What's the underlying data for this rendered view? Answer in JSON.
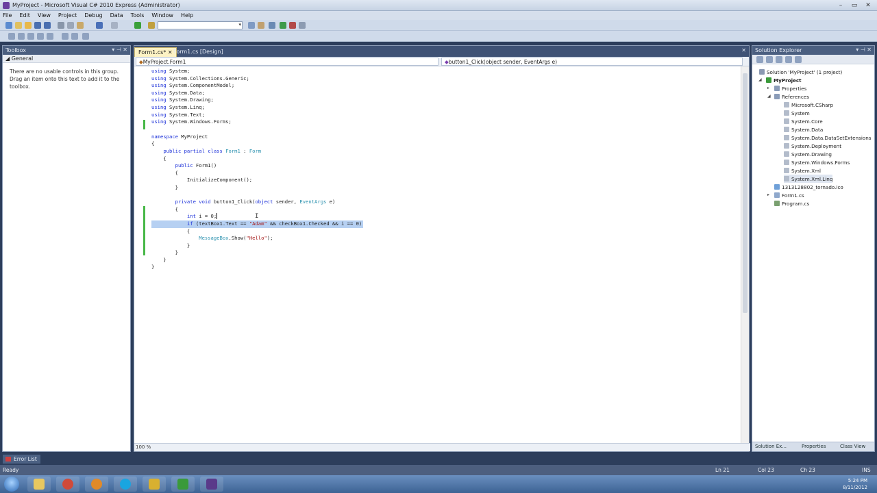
{
  "window": {
    "title": "MyProject - Microsoft Visual C# 2010 Express (Administrator)"
  },
  "menu": [
    "File",
    "Edit",
    "View",
    "Project",
    "Debug",
    "Data",
    "Tools",
    "Window",
    "Help"
  ],
  "toolbox": {
    "title": "Toolbox",
    "group": "General",
    "message": "There are no usable controls in this group. Drag an item onto this text to add it to the toolbox."
  },
  "editor": {
    "tabs": [
      {
        "label": "Form1.cs*",
        "active": true
      },
      {
        "label": "Form1.cs [Design]",
        "active": false
      }
    ],
    "nav_left": "MyProject.Form1",
    "nav_right": "button1_Click(object sender, EventArgs e)",
    "zoom": "100 %",
    "code_lines": [
      "using System;",
      "using System.Collections.Generic;",
      "using System.ComponentModel;",
      "using System.Data;",
      "using System.Drawing;",
      "using System.Linq;",
      "using System.Text;",
      "using System.Windows.Forms;",
      "",
      "namespace MyProject",
      "{",
      "    public partial class Form1 : Form",
      "    {",
      "        public Form1()",
      "        {",
      "            InitializeComponent();",
      "        }",
      "",
      "        private void button1_Click(object sender, EventArgs e)",
      "        {",
      "            int i = 0;",
      "            if (textBox1.Text == \"Adam\" && checkBox1.Checked && i == 0)",
      "            {",
      "                MessageBox.Show(\"Hello\");",
      "            }",
      "        }",
      "    }",
      "}"
    ]
  },
  "solution_explorer": {
    "title": "Solution Explorer",
    "nodes": [
      "Solution 'MyProject' (1 project)",
      "MyProject",
      "Properties",
      "References",
      "Microsoft.CSharp",
      "System",
      "System.Core",
      "System.Data",
      "System.Data.DataSetExtensions",
      "System.Deployment",
      "System.Drawing",
      "System.Windows.Forms",
      "System.Xml",
      "System.Xml.Linq",
      "1313128802_tornado.ico",
      "Form1.cs",
      "Program.cs"
    ],
    "bottom_tabs": [
      "Solution Ex...",
      "Properties",
      "Class View"
    ]
  },
  "error_list": {
    "label": "Error List"
  },
  "status": {
    "ready": "Ready",
    "line": "Ln 21",
    "col": "Col 23",
    "ch": "Ch 23",
    "mode": "INS"
  },
  "clock": {
    "time": "5:24 PM",
    "date": "8/11/2012"
  },
  "colors": {
    "keyword": "#1a2fd8",
    "type": "#2b91af",
    "string": "#a31515",
    "selection": "#b6d0f2",
    "active_tab": "#fdf2c4"
  }
}
